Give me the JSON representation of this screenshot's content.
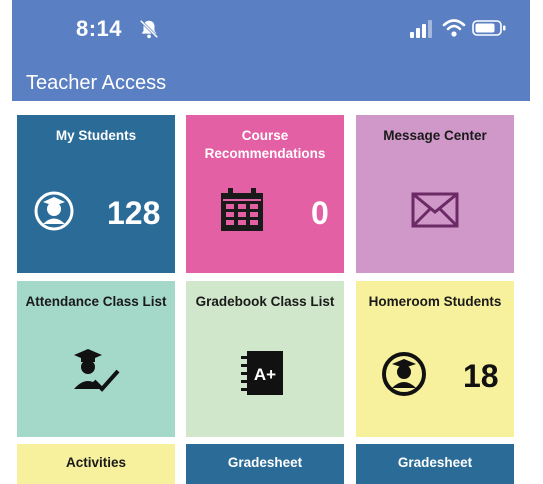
{
  "status_bar": {
    "time": "8:14"
  },
  "header": {
    "title": "Teacher Access"
  },
  "tiles": [
    {
      "label": "My Students",
      "count": "128",
      "color": "#2a6b97"
    },
    {
      "label": "Course Recommendations",
      "count": "0",
      "color": "#e460a4"
    },
    {
      "label": "Message Center",
      "color": "#cf98c8"
    },
    {
      "label": "Attendance Class List",
      "color": "#a4d8c8"
    },
    {
      "label": "Gradebook Class List",
      "color": "#d0e7cb"
    },
    {
      "label": "Homeroom Students",
      "count": "18",
      "color": "#f7f09c"
    }
  ],
  "bottom_tiles": [
    {
      "label": "Activities",
      "color": "#f7f09c"
    },
    {
      "label": "Gradesheet",
      "color": "#2a6b97"
    },
    {
      "label": "Gradesheet",
      "color": "#2a6b97"
    }
  ]
}
